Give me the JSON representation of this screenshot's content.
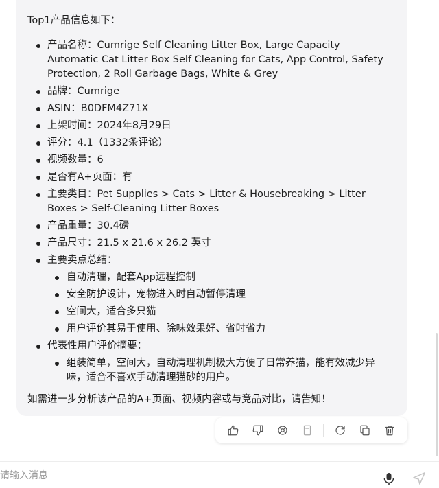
{
  "message": {
    "intro": "Top1产品信息如下：",
    "items": [
      {
        "label": "产品名称：Cumrige Self Cleaning Litter Box, Large Capacity Automatic Cat Litter Box Self Cleaning for Cats, App Control, Safety Protection, 2 Roll Garbage Bags, White & Grey"
      },
      {
        "label": "品牌：Cumrige"
      },
      {
        "label": "ASIN：B0DFM4Z71X"
      },
      {
        "label": "上架时间：2024年8月29日"
      },
      {
        "label": "评分：4.1（1332条评论）"
      },
      {
        "label": "视频数量：6"
      },
      {
        "label": "是否有A+页面：有"
      },
      {
        "label": "主要类目：Pet Supplies > Cats > Litter & Housebreaking > Litter Boxes > Self-Cleaning Litter Boxes"
      },
      {
        "label": "产品重量：30.4磅"
      },
      {
        "label": "产品尺寸：21.5 x 21.6 x 26.2 英寸"
      },
      {
        "label": "主要卖点总结：",
        "sub": [
          "自动清理，配套App远程控制",
          "安全防护设计，宠物进入时自动暂停清理",
          "空间大，适合多只猫",
          "用户评价其易于使用、除味效果好、省时省力"
        ]
      },
      {
        "label": "代表性用户评价摘要：",
        "sub": [
          "组装简单，空间大，自动清理机制极大方便了日常养猫，能有效减少异味，适合不喜欢手动清理猫砂的用户。"
        ]
      }
    ],
    "outro": "如需进一步分析该产品的A+页面、视频内容或与竞品对比，请告知！"
  },
  "actions": {
    "icons": [
      "thumbs-up-icon",
      "thumbs-down-icon",
      "share-icon",
      "bookmark-icon",
      "regenerate-icon",
      "copy-icon",
      "delete-icon"
    ]
  },
  "input": {
    "placeholder": "请输入消息"
  },
  "colors": {
    "bubble": "#f4f4f6",
    "text": "#1f1f1f",
    "icon": "#555555"
  }
}
